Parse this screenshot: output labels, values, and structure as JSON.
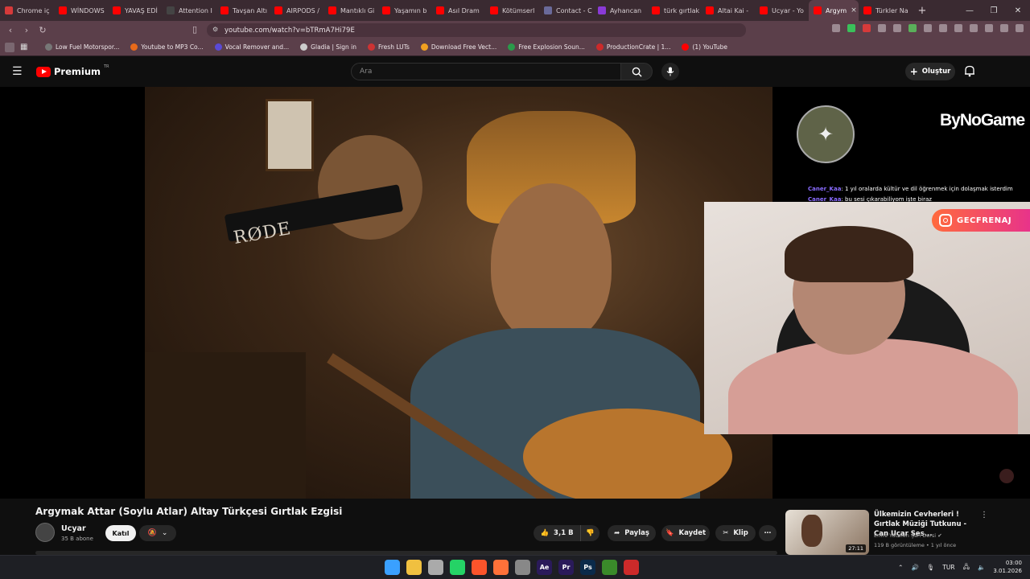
{
  "browser": {
    "tabs": [
      {
        "label": "Chrome iç",
        "color": "#d63a3a"
      },
      {
        "label": "WİNDOWS",
        "color": "#ff0000"
      },
      {
        "label": "YAVAŞ EDİ",
        "color": "#ff0000"
      },
      {
        "label": "Attention I",
        "color": "#444444"
      },
      {
        "label": "Tavşan Altı",
        "color": "#ff0000"
      },
      {
        "label": "AIRPODS /",
        "color": "#ff0000"
      },
      {
        "label": "Mantıklı Gi",
        "color": "#ff0000"
      },
      {
        "label": "Yaşamın b",
        "color": "#ff0000"
      },
      {
        "label": "Asıl Dram",
        "color": "#ff0000"
      },
      {
        "label": "Kötümserl",
        "color": "#ff0000"
      },
      {
        "label": "Contact - C",
        "color": "#6a6a9a"
      },
      {
        "label": "Ayhancan",
        "color": "#8a3ad6"
      },
      {
        "label": "türk gırtlak",
        "color": "#ff0000"
      },
      {
        "label": "Altai Kai -",
        "color": "#ff0000"
      },
      {
        "label": "Ucyar - Yo",
        "color": "#ff0000"
      },
      {
        "label": "Argym",
        "color": "#ff0000"
      },
      {
        "label": "Türkler Na",
        "color": "#ff0000"
      }
    ],
    "active_tab_index": 15,
    "close_tab": "×",
    "new_tab": "+",
    "url": "youtube.com/watch?v=bTRmA7Hi79E",
    "bookmarks": [
      {
        "label": "Low Fuel Motorspor...",
        "color": "#777777"
      },
      {
        "label": "Youtube to MP3 Co...",
        "color": "#e86a1a"
      },
      {
        "label": "Vocal Remover and...",
        "color": "#5a4ad6"
      },
      {
        "label": "Gladia | Sign in",
        "color": "#cccccc"
      },
      {
        "label": "Fresh LUTs",
        "color": "#cc3333"
      },
      {
        "label": "Download Free Vect...",
        "color": "#f0a020"
      },
      {
        "label": "Free Explosion Soun...",
        "color": "#2a9a4a"
      },
      {
        "label": "ProductionCrate | 1...",
        "color": "#cc2a2a"
      },
      {
        "label": "(1) YouTube",
        "color": "#ff0000"
      }
    ]
  },
  "youtube": {
    "logo_text": "Premium",
    "logo_region": "TR",
    "search_placeholder": "Ara",
    "create_label": "Oluştur"
  },
  "overlay": {
    "sponsor": "ByNoGame",
    "chat": [
      {
        "user": "Caner_Kaa",
        "message": ": 1 yıl oralarda kültür ve dil öğrenmek için dolaşmak isterdim"
      },
      {
        "user": "Caner_Kaa",
        "message": ": bu sesi çıkarabiliyom işte biraz"
      }
    ],
    "instagram_handle": "GECFRENAJ",
    "microphone_brand": "RØDE"
  },
  "video": {
    "title": "Argymak Attar (Soylu Atlar) Altay Türkçesi Gırtlak Ezgisi",
    "channel": "Ucyar",
    "subscribers": "35 B abone",
    "join_label": "Katıl",
    "likes": "3,1 B",
    "share_label": "Paylaş",
    "save_label": "Kaydet",
    "clip_label": "Klip"
  },
  "recommended": {
    "title": "Ülkemizin Cevherleri ! Gırtlak Müziği Tutkunu - Can Uçar Ses...",
    "channel": "Emre Yücelen Şan Dersi",
    "meta": "119 B görüntüleme • 1 yıl önce",
    "duration": "27:11"
  },
  "taskbar": {
    "apps": [
      {
        "name": "start",
        "color": "#3aa0ff",
        "label": ""
      },
      {
        "name": "explorer",
        "color": "#f0c040",
        "label": ""
      },
      {
        "name": "notes",
        "color": "#aaaaaa",
        "label": ""
      },
      {
        "name": "whatsapp",
        "color": "#25d366",
        "label": ""
      },
      {
        "name": "brave",
        "color": "#fb542b",
        "label": ""
      },
      {
        "name": "firefox",
        "color": "#ff7139",
        "label": ""
      },
      {
        "name": "chrome",
        "color": "#888888",
        "label": ""
      },
      {
        "name": "after-effects",
        "color": "#2a1a5a",
        "label": "Ae"
      },
      {
        "name": "premiere",
        "color": "#2a1a5a",
        "label": "Pr"
      },
      {
        "name": "photoshop",
        "color": "#0a2a4a",
        "label": "Ps"
      },
      {
        "name": "media",
        "color": "#3a8a2a",
        "label": ""
      },
      {
        "name": "capcut",
        "color": "#cc2a2a",
        "label": ""
      }
    ],
    "language": "TUR",
    "time": "03:00",
    "date": "3.01.2026"
  }
}
